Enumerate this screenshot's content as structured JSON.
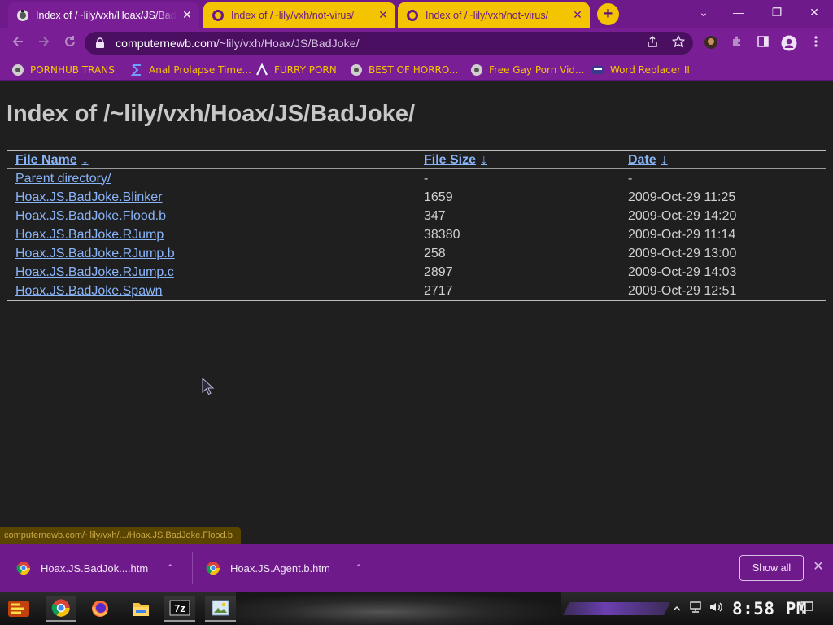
{
  "browser": {
    "tabs": [
      {
        "title": "Index of /~lily/vxh/Hoax/JS/BadJoke/",
        "active": true
      },
      {
        "title": "Index of /~lily/vxh/not-virus/",
        "active": false
      },
      {
        "title": "Index of /~lily/vxh/not-virus/",
        "active": false
      }
    ],
    "tab_close_glyph": "✕",
    "new_tab_glyph": "+",
    "window_controls": {
      "minimize": "—",
      "restore": "❐",
      "close": "✕",
      "tab_search": "⌄"
    },
    "url_host": "computernewb.com",
    "url_path": "/~lily/vxh/Hoax/JS/BadJoke/",
    "bookmarks": [
      {
        "label": "PORNHUB TRANS",
        "icon": "globe-icon"
      },
      {
        "label": "Anal Prolapse Time...",
        "icon": "sigma-icon"
      },
      {
        "label": "FURRY PORN",
        "icon": "lambda-icon"
      },
      {
        "label": "BEST OF HORRO...",
        "icon": "globe-icon"
      },
      {
        "label": "Free Gay Porn Vid...",
        "icon": "globe-icon"
      },
      {
        "label": "Word Replacer II",
        "icon": "wr-icon"
      }
    ],
    "colors": {
      "frame": "#7a1e96",
      "accent": "#f5c400",
      "link": "#8ab4f8"
    }
  },
  "page": {
    "heading": "Index of /~lily/vxh/Hoax/JS/BadJoke/",
    "columns": {
      "name": "File Name",
      "size": "File Size",
      "date": "Date",
      "sort_glyph": "↓"
    },
    "rows": [
      {
        "name": "Parent directory/",
        "size": "-",
        "date": "-"
      },
      {
        "name": "Hoax.JS.BadJoke.Blinker",
        "size": "1659",
        "date": "2009-Oct-29 11:25"
      },
      {
        "name": "Hoax.JS.BadJoke.Flood.b",
        "size": "347",
        "date": "2009-Oct-29 14:20"
      },
      {
        "name": "Hoax.JS.BadJoke.RJump",
        "size": "38380",
        "date": "2009-Oct-29 11:14"
      },
      {
        "name": "Hoax.JS.BadJoke.RJump.b",
        "size": "258",
        "date": "2009-Oct-29 13:00"
      },
      {
        "name": "Hoax.JS.BadJoke.RJump.c",
        "size": "2897",
        "date": "2009-Oct-29 14:03"
      },
      {
        "name": "Hoax.JS.BadJoke.Spawn",
        "size": "2717",
        "date": "2009-Oct-29 12:51"
      }
    ]
  },
  "status_url": "computernewb.com/~lily/vxh/.../Hoax.JS.BadJoke.Flood.b",
  "downloads": {
    "items": [
      {
        "name": "Hoax.JS.BadJok....htm"
      },
      {
        "name": "Hoax.JS.Agent.b.htm"
      }
    ],
    "chevron_glyph": "⌃",
    "show_all_label": "Show all",
    "close_glyph": "✕"
  },
  "taskbar": {
    "apps": [
      "chrome-icon",
      "firefox-icon",
      "file-explorer-icon",
      "7zip-icon",
      "image-viewer-icon"
    ],
    "seven_zip_label": "7z",
    "clock": "8:58 PM"
  }
}
